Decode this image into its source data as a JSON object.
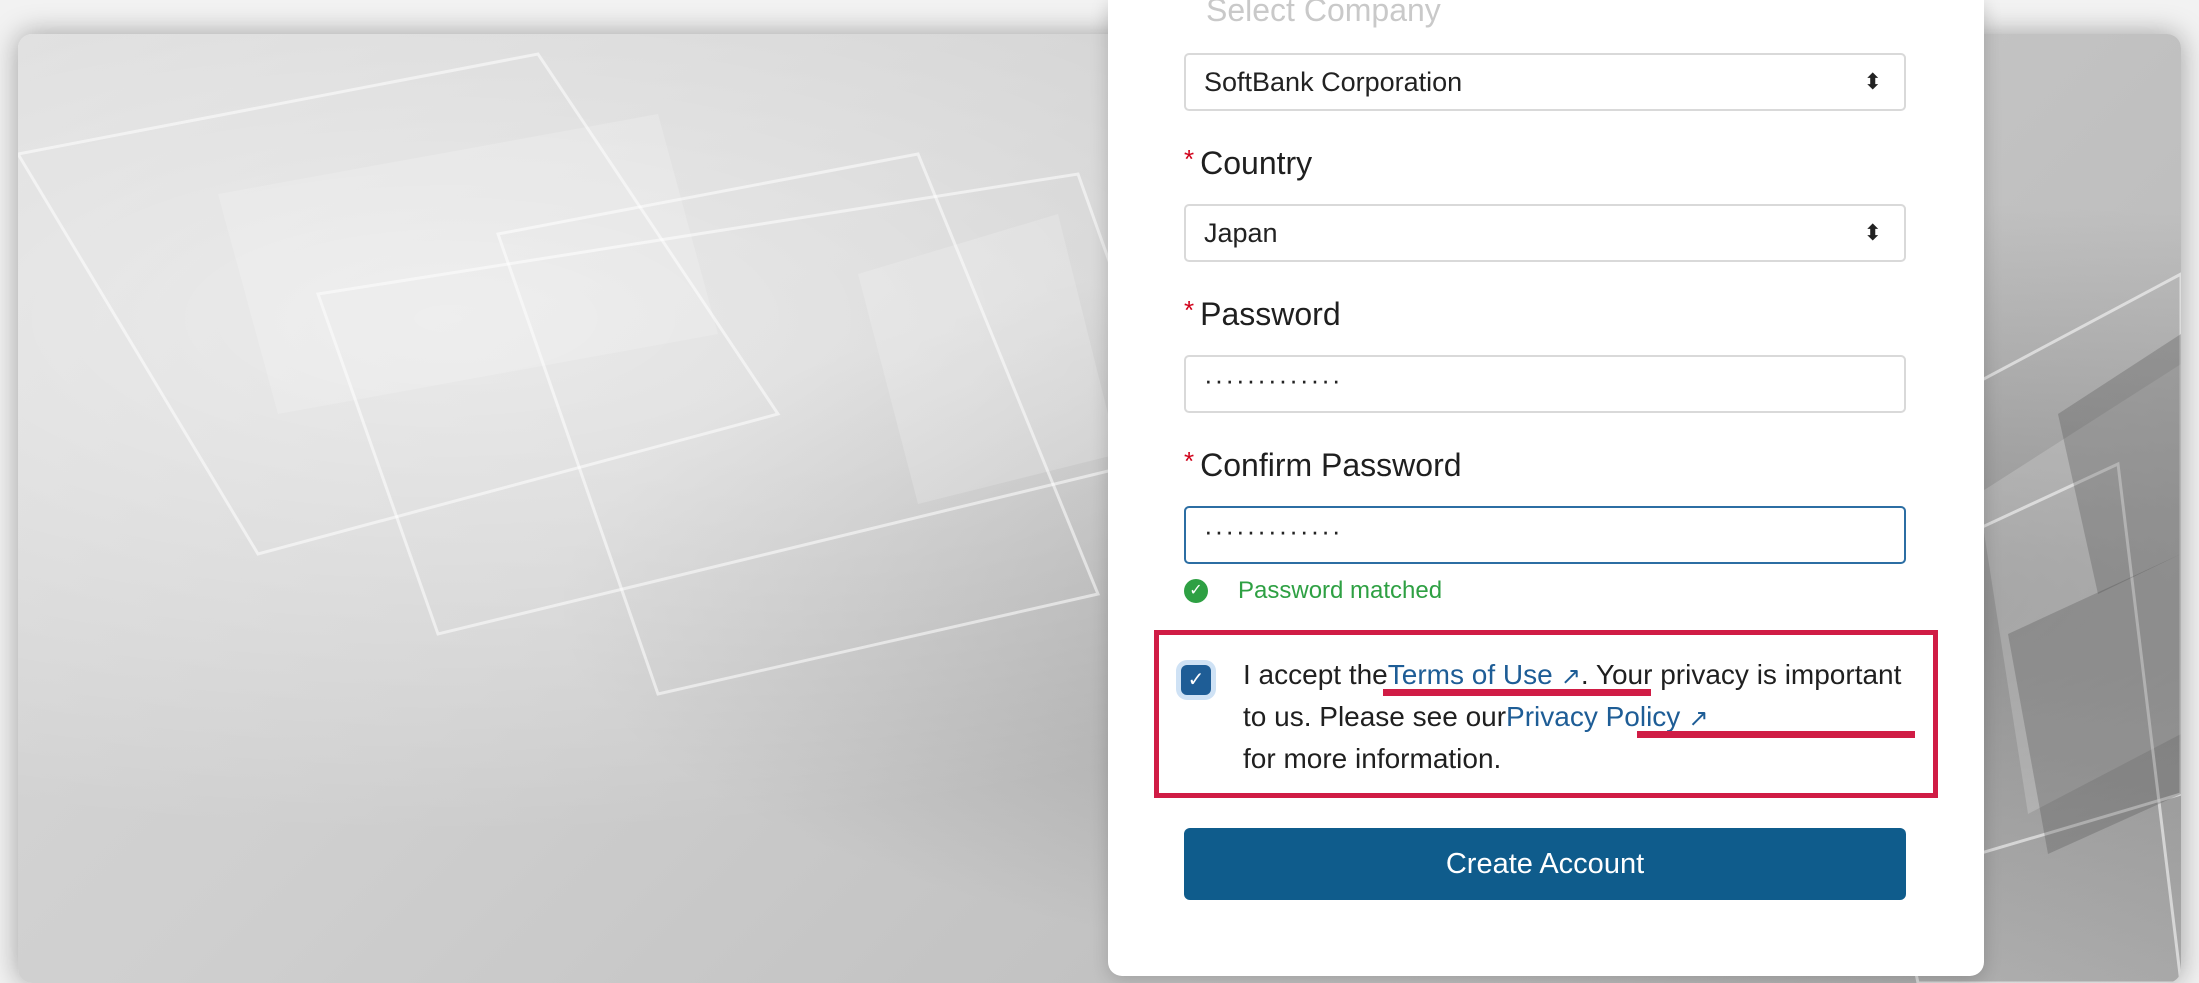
{
  "form": {
    "company_label": "Select Company",
    "company_value": "SoftBank Corporation",
    "country_label": "Country",
    "country_value": "Japan",
    "password_label": "Password",
    "password_value": "·············",
    "confirm_label": "Confirm Password",
    "confirm_value": "·············",
    "required_mark": "*",
    "match_message": "Password matched",
    "terms": {
      "prefix": "I accept the",
      "terms_link": "Terms of Use",
      "middle": ". Your privacy is important to us. Please see our",
      "privacy_link": "Privacy Policy",
      "suffix": "for more information.",
      "checked": true
    },
    "submit_label": "Create Account"
  },
  "icons": {
    "select_arrows": "sort-arrows-icon",
    "match": "check-circle-icon",
    "checkbox": "checkmark-icon",
    "external": "external-link-icon"
  },
  "colors": {
    "primary": "#0f5c8c",
    "link": "#1e5d96",
    "required": "#d0021b",
    "success": "#2ea043",
    "annotation": "#d01c45"
  }
}
